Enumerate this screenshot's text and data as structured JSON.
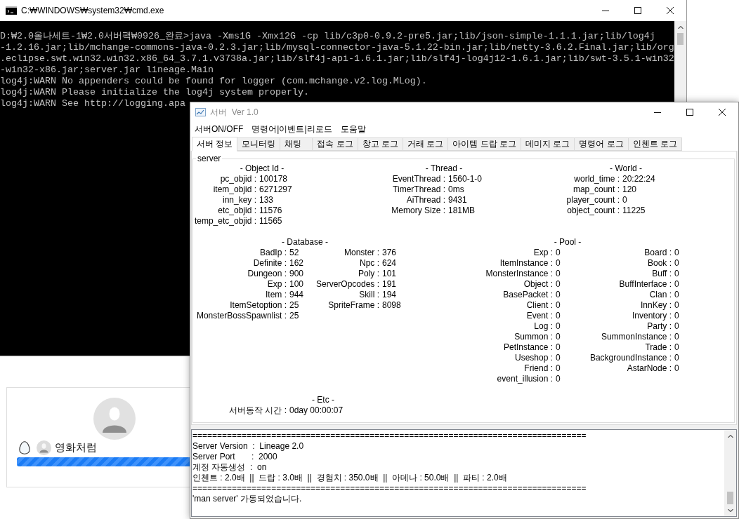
{
  "cmd_window": {
    "title": "C:₩WINDOWS₩system32₩cmd.exe",
    "lines": [
      "D:₩2.0올나세트-1₩2.0서버팩₩0926_완료>java -Xms1G -Xmx12G -cp lib/c3p0-0.9.2-pre5.jar;lib/json-simple-1.1.1.jar;lib/log4j",
      "-1.2.16.jar;lib/mchange-commons-java-0.2.3.jar;lib/mysql-connector-java-5.1.22-bin.jar;lib/netty-3.6.2.Final.jar;lib/org",
      ".eclipse.swt.win32.win32.x86_64_3.7.1.v3738a.jar;lib/slf4j-api-1.6.1.jar;lib/slf4j-log4j12-1.6.1.jar;lib/swt-3.5.1-win32",
      "-win32-x86.jar;server.jar lineage.Main",
      "log4j:WARN No appenders could be found for logger (com.mchange.v2.log.MLog).",
      "log4j:WARN Please initialize the log4j system properly.",
      "log4j:WARN See http://logging.apa"
    ]
  },
  "profile_card": {
    "name": "영화처럼",
    "progress": {
      "level": 1
    }
  },
  "server_window": {
    "title": "서버  Ver 1.0",
    "menu": [
      "서버ON/OFF",
      "명령어|이벤트|리로드",
      "도움말"
    ],
    "tabs": [
      {
        "label": "서버 정보",
        "selected": true
      },
      {
        "label": "모니터링",
        "selected": false
      },
      {
        "label": "채팅",
        "selected": false
      },
      {
        "label": "접속 로그",
        "selected": false
      },
      {
        "label": "창고 로그",
        "selected": false
      },
      {
        "label": "거래 로그",
        "selected": false
      },
      {
        "label": "아이템 드랍 로그",
        "selected": false
      },
      {
        "label": "데미지 로그",
        "selected": false
      },
      {
        "label": "명령어 로그",
        "selected": false
      },
      {
        "label": "인첸트 로그",
        "selected": false
      }
    ],
    "panel": {
      "title": "server",
      "sections": [
        {
          "title": "- Object Id -",
          "columns": [
            {
              "items": [
                {
                  "label": "pc_objid :",
                  "value": "100178"
                },
                {
                  "label": "item_objid :",
                  "value": "6271297"
                },
                {
                  "label": "inn_key :",
                  "value": "133"
                },
                {
                  "label": "etc_objid :",
                  "value": "11576"
                },
                {
                  "label": "temp_etc_objid :",
                  "value": "11565"
                }
              ]
            }
          ]
        },
        {
          "title": "- Thread -",
          "columns": [
            {
              "items": [
                {
                  "label": "EventThread :",
                  "value": "1560-1-0"
                },
                {
                  "label": "TimerThread :",
                  "value": "0ms"
                },
                {
                  "label": "AiThread :",
                  "value": "9431"
                },
                {
                  "label": "Memory Size :",
                  "value": "181MB"
                }
              ]
            }
          ]
        },
        {
          "title": "- World -",
          "columns": [
            {
              "items": [
                {
                  "label": "world_time :",
                  "value": "20:22:24"
                },
                {
                  "label": "map_count :",
                  "value": "120"
                },
                {
                  "label": "player_count :",
                  "value": "0"
                },
                {
                  "label": "object_count :",
                  "value": "11225"
                }
              ]
            }
          ]
        },
        {
          "title": "- Database -",
          "columns": [
            {
              "items": [
                {
                  "label": "BadIp :",
                  "value": "52"
                },
                {
                  "label": "Definite :",
                  "value": "162"
                },
                {
                  "label": "Dungeon :",
                  "value": "900"
                },
                {
                  "label": "Exp :",
                  "value": "100"
                },
                {
                  "label": "Item :",
                  "value": "944"
                },
                {
                  "label": "ItemSetoption :",
                  "value": "25"
                },
                {
                  "label": "MonsterBossSpawnlist :",
                  "value": "25"
                }
              ]
            },
            {
              "items": [
                {
                  "label": "Monster :",
                  "value": "376"
                },
                {
                  "label": "Npc :",
                  "value": "624"
                },
                {
                  "label": "Poly :",
                  "value": "101"
                },
                {
                  "label": "ServerOpcodes :",
                  "value": "191"
                },
                {
                  "label": "Skill :",
                  "value": "194"
                },
                {
                  "label": "SpriteFrame :",
                  "value": "8098"
                }
              ]
            }
          ]
        },
        {
          "title": "- Pool -",
          "columns": [
            {
              "items": [
                {
                  "label": "Exp :",
                  "value": "0"
                },
                {
                  "label": "ItemInstance :",
                  "value": "0"
                },
                {
                  "label": "MonsterInstance :",
                  "value": "0"
                },
                {
                  "label": "Object :",
                  "value": "0"
                },
                {
                  "label": "BasePacket :",
                  "value": "0"
                },
                {
                  "label": "Client :",
                  "value": "0"
                },
                {
                  "label": "Event :",
                  "value": "0"
                },
                {
                  "label": "Log :",
                  "value": "0"
                },
                {
                  "label": "Summon :",
                  "value": "0"
                },
                {
                  "label": "PetInstance :",
                  "value": "0"
                },
                {
                  "label": "Useshop :",
                  "value": "0"
                },
                {
                  "label": "Friend :",
                  "value": "0"
                },
                {
                  "label": "event_illusion :",
                  "value": "0"
                }
              ]
            },
            {
              "items": [
                {
                  "label": "Board :",
                  "value": "0"
                },
                {
                  "label": "Book :",
                  "value": "0"
                },
                {
                  "label": "Buff :",
                  "value": "0"
                },
                {
                  "label": "BuffInterface :",
                  "value": "0"
                },
                {
                  "label": "Clan :",
                  "value": "0"
                },
                {
                  "label": "InnKey :",
                  "value": "0"
                },
                {
                  "label": "Inventory :",
                  "value": "0"
                },
                {
                  "label": "Party :",
                  "value": "0"
                },
                {
                  "label": "SummonInstance :",
                  "value": "0"
                },
                {
                  "label": "Trade :",
                  "value": "0"
                },
                {
                  "label": "BackgroundInstance :",
                  "value": "0"
                },
                {
                  "label": "AstarNode :",
                  "value": "0"
                }
              ]
            }
          ]
        },
        {
          "title": "- Etc -",
          "columns": [
            {
              "items": [
                {
                  "label": "서버동작 시간 :",
                  "value": "0day 00:00:07"
                }
              ]
            }
          ]
        }
      ]
    },
    "log": {
      "lines": [
        "================================================================================",
        "Server Version  :  Lineage 2.0",
        "Server Port       :  2000",
        "계정 자동생성  :  on",
        "인첸트 : 2.0배  ||  드랍 : 3.0배  ||  경험치 : 350.0배  ||  아데나 : 50.0배  ||  파티 : 2.0배",
        "================================================================================",
        "'man server' 가동되었습니다."
      ]
    }
  }
}
